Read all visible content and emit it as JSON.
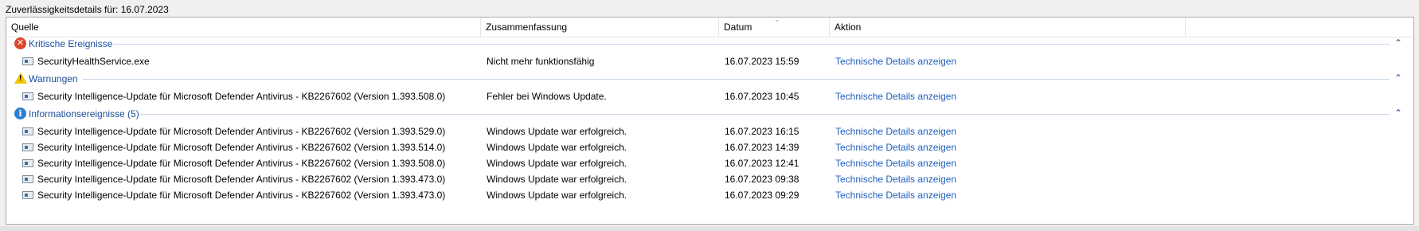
{
  "title": "Zuverlässigkeitsdetails für: 16.07.2023",
  "columns": [
    "Quelle",
    "Zusammenfassung",
    "Datum",
    "Aktion"
  ],
  "groups": [
    {
      "label": "Kritische Ereignisse",
      "icon": "error-icon",
      "rows": [
        {
          "source": "SecurityHealthService.exe",
          "summary": "Nicht mehr funktionsfähig",
          "date": "16.07.2023 15:59",
          "action": "Technische Details anzeigen"
        }
      ]
    },
    {
      "label": "Warnungen",
      "icon": "warning-icon",
      "rows": [
        {
          "source": "Security Intelligence-Update für Microsoft Defender Antivirus - KB2267602 (Version 1.393.508.0)",
          "summary": "Fehler bei Windows Update.",
          "date": "16.07.2023 10:45",
          "action": "Technische Details anzeigen"
        }
      ]
    },
    {
      "label": "Informationsereignisse (5)",
      "icon": "info-icon",
      "rows": [
        {
          "source": "Security Intelligence-Update für Microsoft Defender Antivirus - KB2267602 (Version 1.393.529.0)",
          "summary": "Windows Update war erfolgreich.",
          "date": "16.07.2023 16:15",
          "action": "Technische Details anzeigen"
        },
        {
          "source": "Security Intelligence-Update für Microsoft Defender Antivirus - KB2267602 (Version 1.393.514.0)",
          "summary": "Windows Update war erfolgreich.",
          "date": "16.07.2023 14:39",
          "action": "Technische Details anzeigen"
        },
        {
          "source": "Security Intelligence-Update für Microsoft Defender Antivirus - KB2267602 (Version 1.393.508.0)",
          "summary": "Windows Update war erfolgreich.",
          "date": "16.07.2023 12:41",
          "action": "Technische Details anzeigen"
        },
        {
          "source": "Security Intelligence-Update für Microsoft Defender Antivirus - KB2267602 (Version 1.393.473.0)",
          "summary": "Windows Update war erfolgreich.",
          "date": "16.07.2023 09:38",
          "action": "Technische Details anzeigen"
        },
        {
          "source": "Security Intelligence-Update für Microsoft Defender Antivirus - KB2267602 (Version 1.393.473.0)",
          "summary": "Windows Update war erfolgreich.",
          "date": "16.07.2023 09:29",
          "action": "Technische Details anzeigen"
        }
      ]
    }
  ],
  "colors": {
    "group_label": "#1a4f9c",
    "link": "#1f5fbf",
    "error": "#d9492e",
    "warning": "#f2c500",
    "info": "#2a7fd4"
  }
}
